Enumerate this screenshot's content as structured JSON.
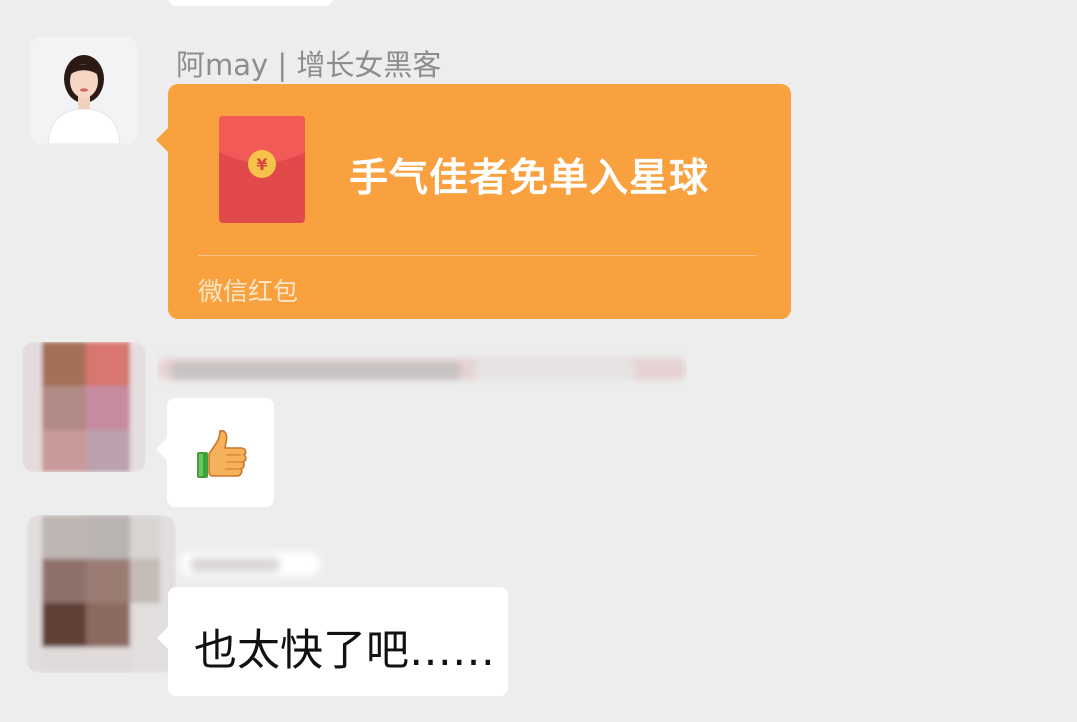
{
  "colors": {
    "background": "#ededed",
    "red_packet": "#f9a03f",
    "bubble": "#ffffff",
    "name_text": "#8d8d8d",
    "message_text": "#111111"
  },
  "messages": [
    {
      "sender_name": "阿may | 增长女黑客",
      "avatar": "woman-portrait-avatar",
      "type": "red_packet",
      "red_packet": {
        "title": "手气佳者免单入星球",
        "footer": "微信红包",
        "icon": "red-envelope-icon",
        "icon_symbol": "¥"
      }
    },
    {
      "sender_name_blurred": true,
      "avatar": "pixelated-avatar",
      "type": "sticker",
      "sticker": "thumbs-up-icon"
    },
    {
      "sender_name_blurred": true,
      "avatar": "pixelated-avatar",
      "type": "text",
      "text": "也太快了吧……"
    }
  ]
}
